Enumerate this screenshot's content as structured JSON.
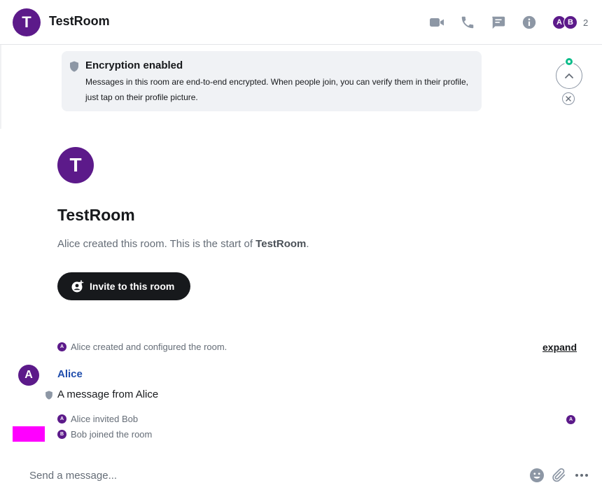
{
  "header": {
    "room_avatar_letter": "T",
    "room_name": "TestRoom",
    "icons": [
      "video-call-icon",
      "voice-call-icon",
      "threads-icon",
      "room-info-icon"
    ],
    "facepile": {
      "members": [
        "A",
        "B"
      ],
      "count": "2"
    }
  },
  "encryption_notice": {
    "title": "Encryption enabled",
    "description": "Messages in this room are end-to-end encrypted. When people join, you can verify them in their profile, just tap on their profile picture."
  },
  "room_intro": {
    "avatar_letter": "T",
    "title": "TestRoom",
    "created_prefix": "Alice created this room. This is the start of ",
    "created_room": "TestRoom",
    "created_suffix": ".",
    "invite_label": "Invite to this room"
  },
  "timeline": {
    "summary": {
      "avatar": "A",
      "text": "Alice created and configured the room.",
      "expand_label": "expand"
    },
    "message": {
      "avatar": "A",
      "sender": "Alice",
      "body": "A message from Alice"
    },
    "events": [
      {
        "avatar": "A",
        "text": "Alice invited Bob"
      },
      {
        "avatar": "B",
        "text": "Bob joined the room"
      }
    ],
    "read_receipt": "A"
  },
  "composer": {
    "placeholder": "Send a message...",
    "icons": [
      "emoji-icon",
      "attachment-icon",
      "more-options-icon"
    ]
  },
  "colors": {
    "avatar": "#5c1a8a",
    "sender_name": "#1f4dac",
    "unread_dot": "#0dbd8b",
    "invite_button": "#17191c",
    "notice_bg": "#f0f2f5"
  }
}
